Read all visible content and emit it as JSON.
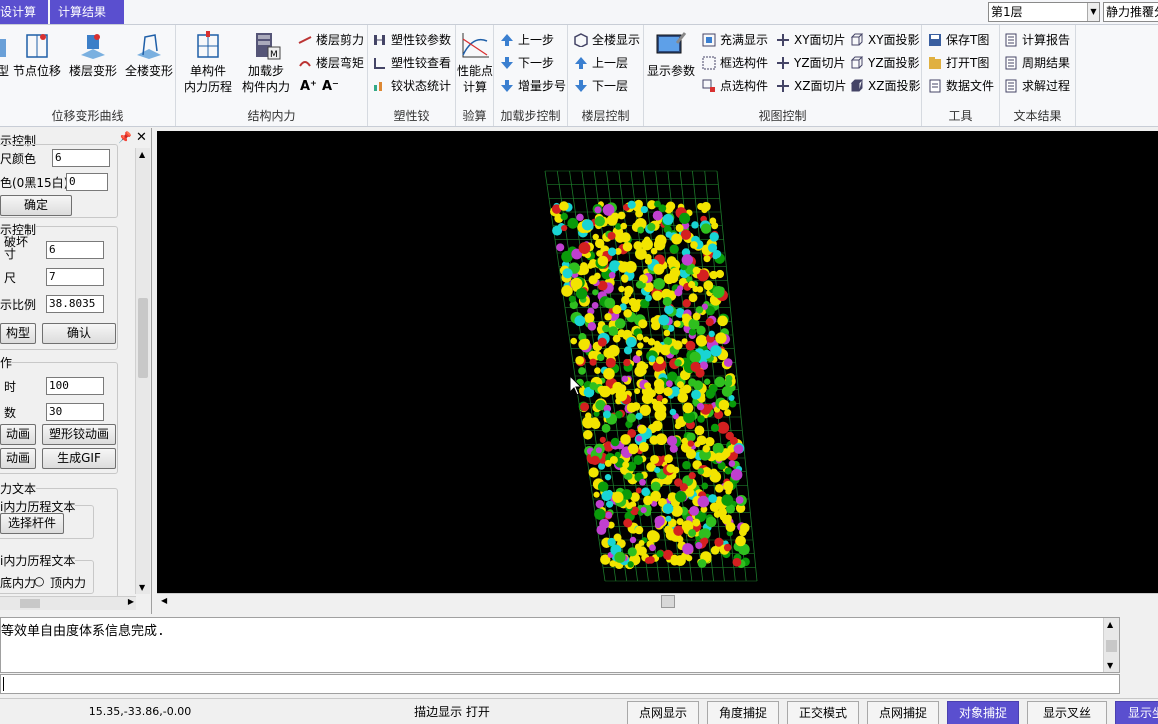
{
  "tabs": [
    {
      "label": "设计算"
    },
    {
      "label": "计算结果"
    }
  ],
  "layer_select": "第1层",
  "analysis_select": "静力推覆分",
  "ribbon": {
    "groups": [
      {
        "label": "位移变形曲线",
        "buttons": [
          "节点位移",
          "楼层变形",
          "全楼变形"
        ],
        "cut_label": "型"
      },
      {
        "label": "结构内力",
        "big": [
          {
            "l1": "单构件",
            "l2": "内力历程"
          },
          {
            "l1": "加载步",
            "l2": "构件内力"
          }
        ],
        "small": [
          "楼层剪力",
          "楼层弯矩"
        ],
        "font_up": "A⁺",
        "font_down": "A⁻"
      },
      {
        "label": "塑性铰",
        "small": [
          "塑性铰参数",
          "塑性铰查看",
          "铰状态统计"
        ]
      },
      {
        "label": "验算",
        "big": {
          "l1": "性能点",
          "l2": "计算"
        }
      },
      {
        "label": "加载步控制",
        "small": [
          "上一步",
          "下一步",
          "增量步号"
        ]
      },
      {
        "label": "楼层控制",
        "small": [
          "全楼显示",
          "上一层",
          "下一层"
        ]
      },
      {
        "label": "视图控制",
        "big": "显示参数",
        "small": [
          "充满显示",
          "框选构件",
          "点选构件",
          "XY面切片",
          "YZ面切片",
          "XZ面切片",
          "XY面投影",
          "YZ面投影",
          "XZ面投影"
        ]
      },
      {
        "label": "工具",
        "small": [
          "保存T图",
          "打开T图",
          "数据文件"
        ]
      },
      {
        "label": "文本结果",
        "small": [
          "计算报告",
          "周期结果",
          "求解过程"
        ]
      }
    ]
  },
  "left_panel": {
    "title": "示控制",
    "color_label": "尺颜色",
    "color_value": "6",
    "bg_label": "色(0黑15白)",
    "bg_value": "0",
    "confirm1": "确定",
    "section2": "示控制",
    "damage_label1": "破坏",
    "damage_label2": "寸",
    "damage_value": "6",
    "size_label": "尺",
    "size_value": "7",
    "scale_label": "示比例",
    "scale_value": "38.8035",
    "model_btn": "构型",
    "confirm2": "确认",
    "section3": "作",
    "time_label": "时",
    "time_value": "100",
    "count_label": "数",
    "count_value": "30",
    "anim1": "动画",
    "anim2": "塑形铰动画",
    "anim3": "动画",
    "gif": "生成GIF",
    "section4": "力文本",
    "sub1": "i内力历程文本",
    "select_btn": "选择杆件",
    "sub2": "i内力历程文本",
    "radio1": "底内力",
    "radio2": "顶内力"
  },
  "output": {
    "message": "等效单自由度体系信息完成."
  },
  "status": {
    "coords": "15.35,-33.86,-0.00",
    "edge": "描边显示  打开",
    "buttons": [
      "点网显示",
      "角度捕捉",
      "正交模式",
      "点网捕捉",
      "对象捕捉",
      "显示叉丝",
      "显示坐"
    ]
  },
  "colors": {
    "accent": "#5a4fcf",
    "canvas": "#000000"
  }
}
